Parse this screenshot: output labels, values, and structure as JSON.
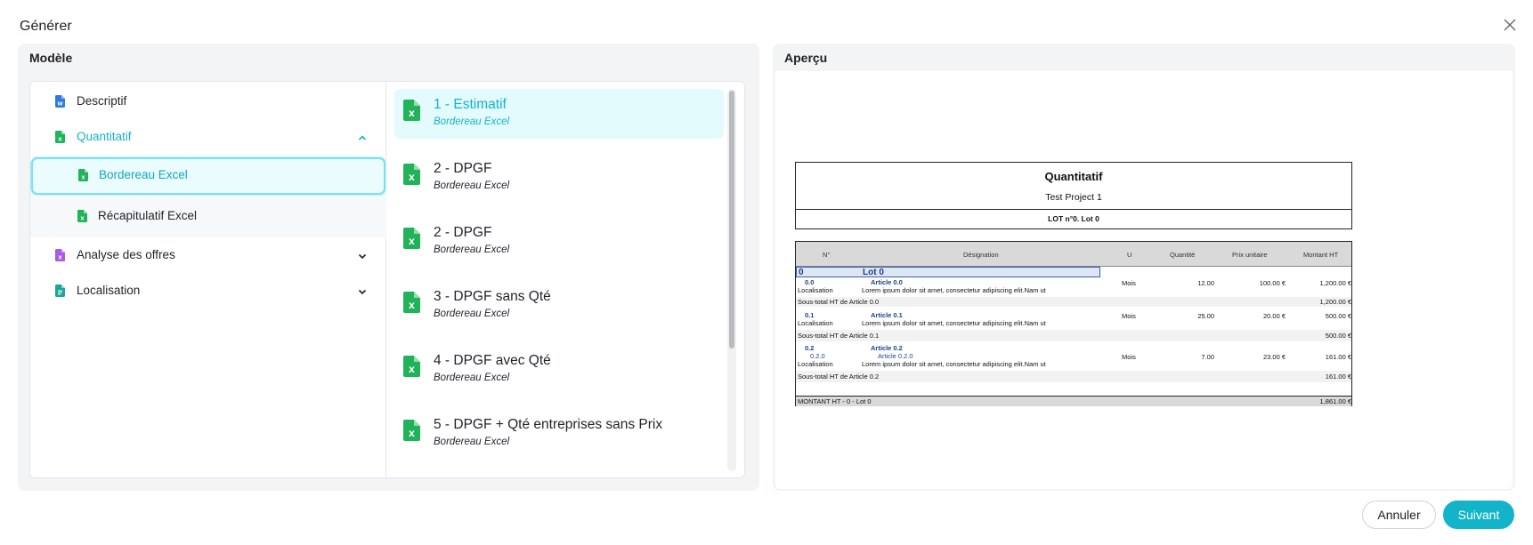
{
  "dialog": {
    "title": "Générer"
  },
  "model_panel": {
    "header": "Modèle",
    "tree": [
      {
        "label": "Descriptif",
        "icon": "word-file-icon",
        "color": "#2f7be5"
      },
      {
        "label": "Quantitatif",
        "icon": "excel-file-icon",
        "color": "#21b35a",
        "expanded": true,
        "children": [
          {
            "label": "Bordereau Excel",
            "icon": "excel-file-icon",
            "selected": true
          },
          {
            "label": "Récapitulatif Excel",
            "icon": "excel-file-icon"
          }
        ]
      },
      {
        "label": "Analyse des offres",
        "icon": "purple-file-icon",
        "color": "#a55ce6"
      },
      {
        "label": "Localisation",
        "icon": "teal-file-icon",
        "color": "#1aa79a"
      }
    ],
    "templates": [
      {
        "title": "1 - Estimatif",
        "subtitle": "Bordereau Excel",
        "active": true
      },
      {
        "title": "2 - DPGF",
        "subtitle": "Bordereau Excel"
      },
      {
        "title": "2 - DPGF",
        "subtitle": "Bordereau Excel"
      },
      {
        "title": "3 - DPGF sans Qté",
        "subtitle": "Bordereau Excel"
      },
      {
        "title": "4 - DPGF avec Qté",
        "subtitle": "Bordereau Excel"
      },
      {
        "title": "5 - DPGF + Qté entreprises sans Prix",
        "subtitle": "Bordereau Excel"
      }
    ]
  },
  "preview_panel": {
    "header": "Aperçu",
    "sheet": {
      "title": "Quantitatif",
      "project": "Test Project 1",
      "lot": "LOT n°0. Lot 0",
      "columns": [
        "N°",
        "Désignation",
        "U",
        "Quantité",
        "Prix unitaire",
        "Montant HT"
      ],
      "lot_row": {
        "num": "0",
        "label": "Lot 0"
      },
      "articles": [
        {
          "num": "0.0",
          "name": "Article 0.0",
          "loc_label": "Localisation",
          "desc": "Lorem ipsum dolor sit amet, consectetur adipiscing elit.Nam ut",
          "unit": "Mois",
          "qty": "12.00",
          "price": "100.00 €",
          "amount": "1,200.00 €",
          "subtotal_label": "Sous-total HT de Article 0.0",
          "subtotal": "1,200.00 €"
        },
        {
          "num": "0.1",
          "name": "Article 0.1",
          "loc_label": "Localisation",
          "desc": "Lorem ipsum dolor sit amet, consectetur adipiscing elit.Nam ut",
          "unit": "Mois",
          "qty": "25.00",
          "price": "20.00 €",
          "amount": "500.00 €",
          "subtotal_label": "Sous-total HT de Article 0.1",
          "subtotal": "500.00 €"
        },
        {
          "num": "0.2",
          "name": "Article 0.2",
          "sub_num": "0.2.0",
          "sub_name": "Article 0.2.0",
          "loc_label": "Localisation",
          "desc": "Lorem ipsum dolor sit amet, consectetur adipiscing elit.Nam ut",
          "unit": "Mois",
          "qty": "7.00",
          "price": "23.00 €",
          "amount": "161.00 €",
          "subtotal_label": "Sous-total HT de Article 0.2",
          "subtotal": "161.00 €"
        }
      ],
      "total_label": "MONTANT HT - 0 - Lot 0",
      "total": "1,861.00 €"
    }
  },
  "footer": {
    "cancel_label": "Annuler",
    "next_label": "Suivant"
  },
  "colors": {
    "accent": "#13b3c9",
    "excel_green": "#21b35a"
  }
}
